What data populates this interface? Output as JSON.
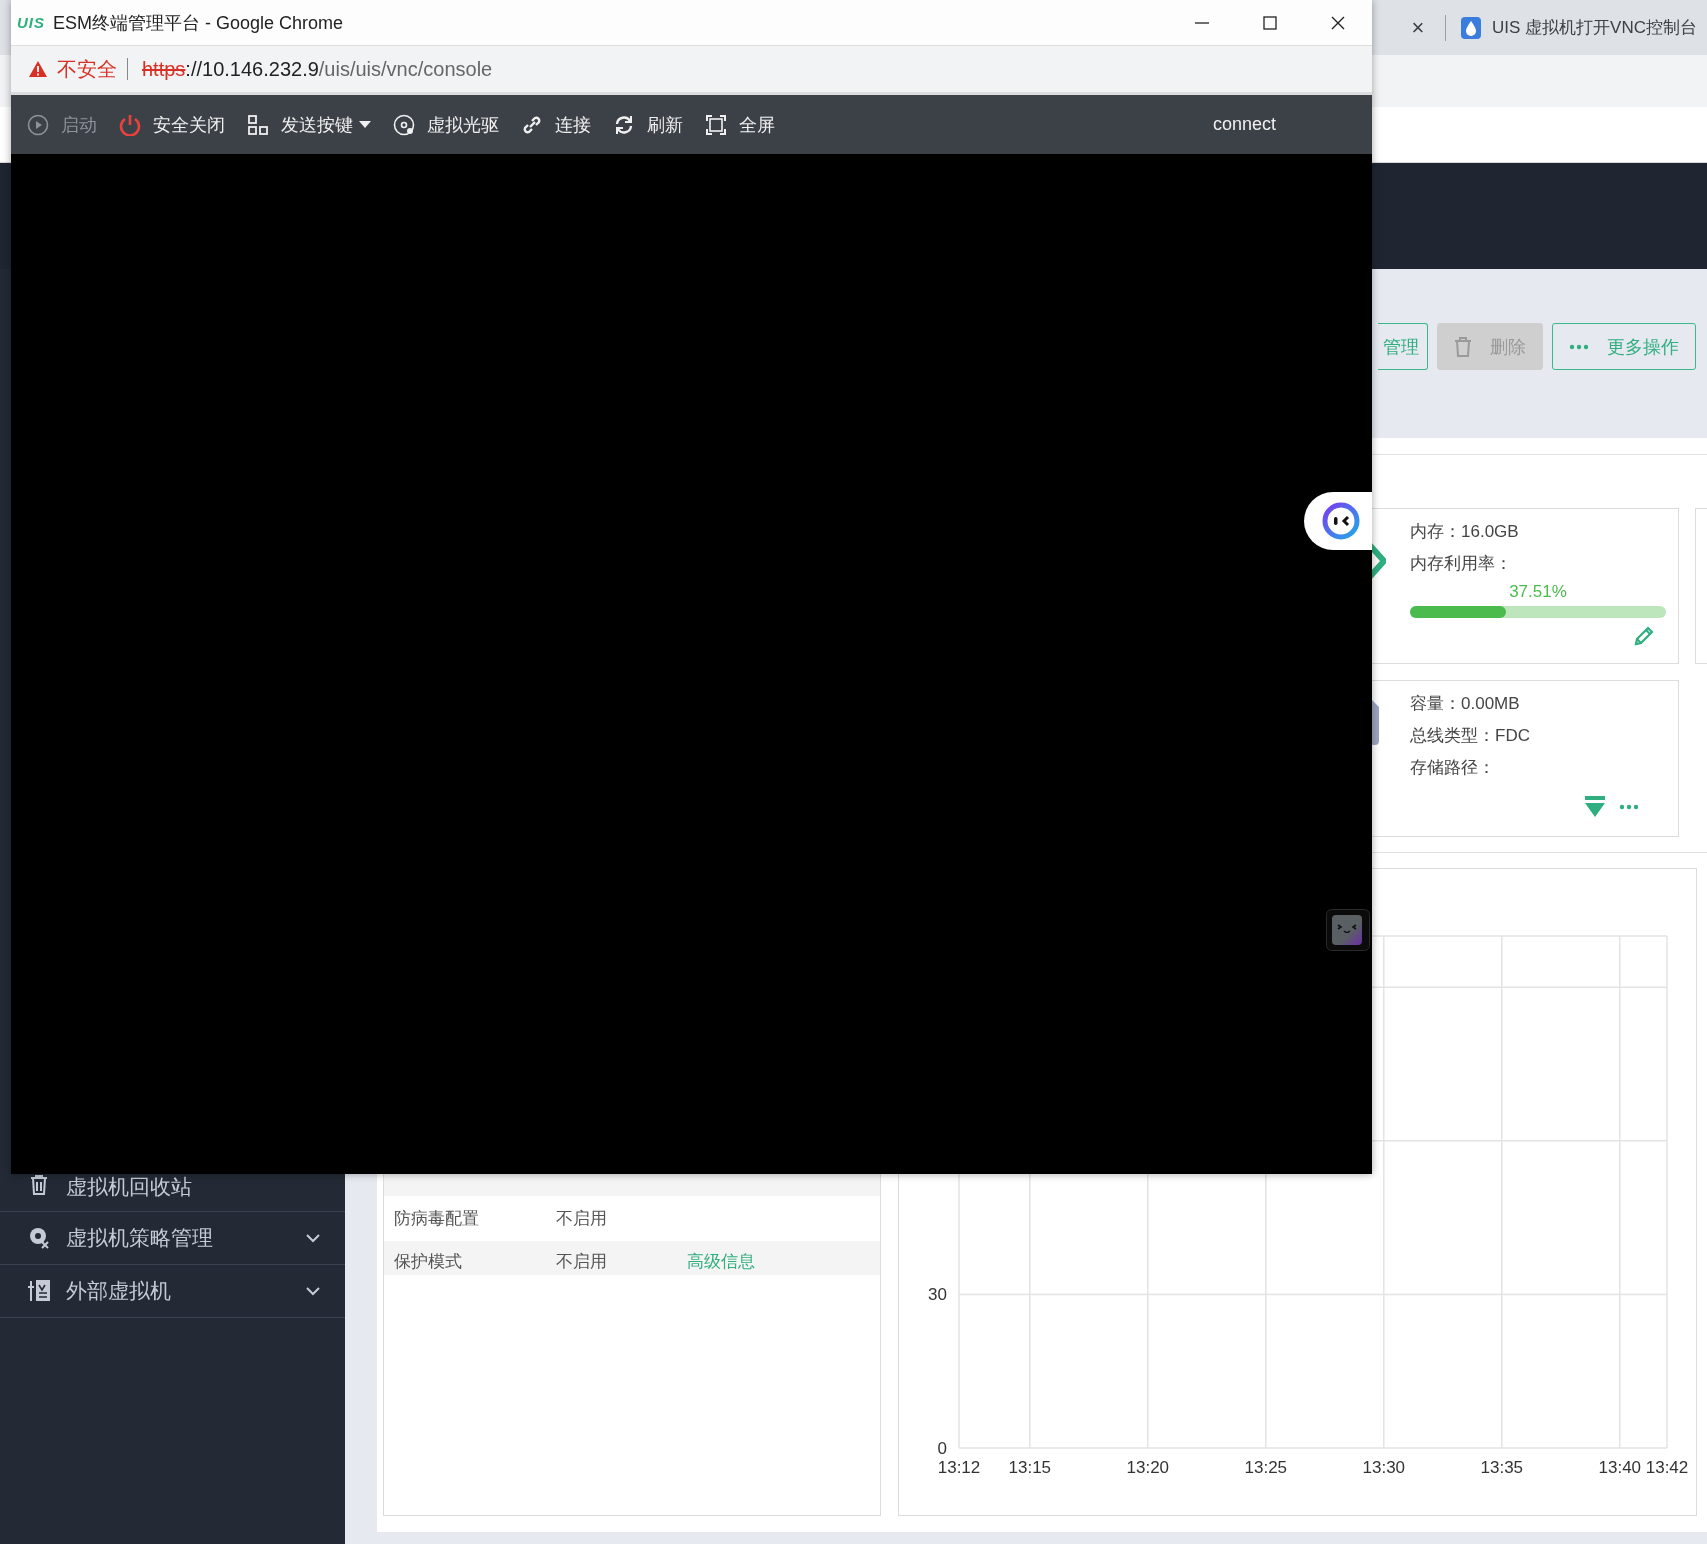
{
  "background_window": {
    "tab_close": "×",
    "tab_title": "UIS 虚拟机打开VNC控制台"
  },
  "sidebar": {
    "items": [
      {
        "label": "虚拟机回收站",
        "has_submenu": false
      },
      {
        "label": "虚拟机策略管理",
        "has_submenu": true
      },
      {
        "label": "外部虚拟机",
        "has_submenu": true
      }
    ]
  },
  "actions": [
    {
      "label": "管理",
      "kind": "plain",
      "disabled": false
    },
    {
      "label": "删除",
      "kind": "trash",
      "disabled": true
    },
    {
      "label": "更多操作",
      "kind": "more",
      "disabled": false
    }
  ],
  "memory_card": {
    "size": "内存：16.0GB",
    "usage_label": "内存利用率：",
    "usage_reading": "37.51%",
    "level": 0.3751
  },
  "disk_card": {
    "lines": [
      "容量：0.00MB",
      "总线类型：FDC",
      "存储路径："
    ]
  },
  "info_table": {
    "rows": [
      {
        "label": "防病毒配置",
        "value": "不启用"
      },
      {
        "label": "保护模式",
        "value": "不启用",
        "link": "高级信息"
      }
    ]
  },
  "chart": {
    "chart_data": {
      "type": "line",
      "grid": true,
      "ylim": [
        0,
        100
      ],
      "yticks": [
        0,
        30
      ],
      "categories": [
        "13:12",
        null,
        null,
        "13:15",
        null,
        null,
        null,
        null,
        "13:20",
        null,
        null,
        null,
        null,
        "13:25",
        null,
        null,
        null,
        null,
        "13:30",
        null,
        null,
        null,
        null,
        "13:35",
        null,
        null,
        null,
        null,
        "13:40",
        null,
        "13:42"
      ]
    }
  },
  "popup_window": {
    "logo": "UIS",
    "title": "ESM终端管理平台 - Google Chrome",
    "security_label": "不安全",
    "url": {
      "scheme": "https",
      "host": "://10.146.232.9",
      "path": "/uis/uis/vnc/console"
    },
    "toolbar": [
      {
        "label": "启动",
        "disabled": true
      },
      {
        "label": "安全关闭",
        "disabled": false
      },
      {
        "label": "发送按键",
        "disabled": false,
        "dropdown": true
      },
      {
        "label": "虚拟光驱",
        "disabled": false
      },
      {
        "label": "连接",
        "disabled": false
      },
      {
        "label": "刷新",
        "disabled": false
      },
      {
        "label": "全屏",
        "disabled": false
      }
    ],
    "status": "connect"
  }
}
